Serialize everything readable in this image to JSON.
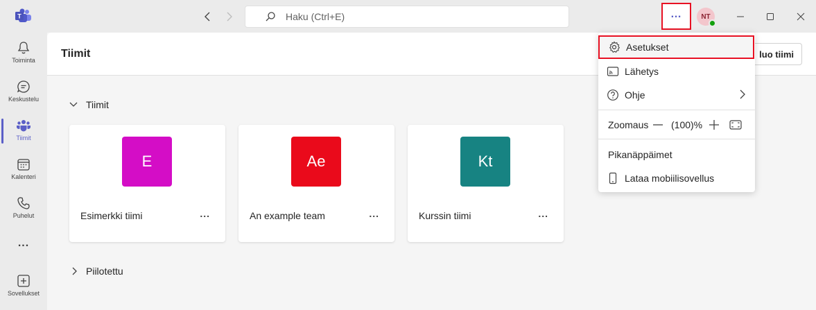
{
  "search": {
    "placeholder": "Haku (Ctrl+E)"
  },
  "user": {
    "initials": "NT"
  },
  "rail": [
    {
      "label": "Toiminta",
      "icon": "bell-icon"
    },
    {
      "label": "Keskustelu",
      "icon": "chat-icon"
    },
    {
      "label": "Tiimit",
      "icon": "teams-icon"
    },
    {
      "label": "Kalenteri",
      "icon": "calendar-icon"
    },
    {
      "label": "Puhelut",
      "icon": "phone-icon"
    },
    {
      "label": "Sovellukset",
      "icon": "plus-square-icon"
    }
  ],
  "rail_more": "...",
  "header": {
    "title": "Tiimit",
    "create_label": "luo tiimi"
  },
  "sections": {
    "teams_label": "Tiimit",
    "hidden_label": "Piilotettu"
  },
  "teams": [
    {
      "initials": "E",
      "name": "Esimerkki tiimi",
      "color": "#d40dc6"
    },
    {
      "initials": "Ae",
      "name": "An example team",
      "color": "#ea0a1b"
    },
    {
      "initials": "Kt",
      "name": "Kurssin tiimi",
      "color": "#178382"
    }
  ],
  "team_more": "...",
  "menu": {
    "settings": "Asetukset",
    "cast": "Lähetys",
    "help": "Ohje",
    "zoom_label": "Zoomaus",
    "zoom_value": "(100)%",
    "shortcuts": "Pikanäppäimet",
    "download_mobile": "Lataa mobiilisovellus"
  },
  "colors": {
    "accent": "#5b5fc7",
    "highlight": "#e81123",
    "presence": "#13a10e"
  }
}
